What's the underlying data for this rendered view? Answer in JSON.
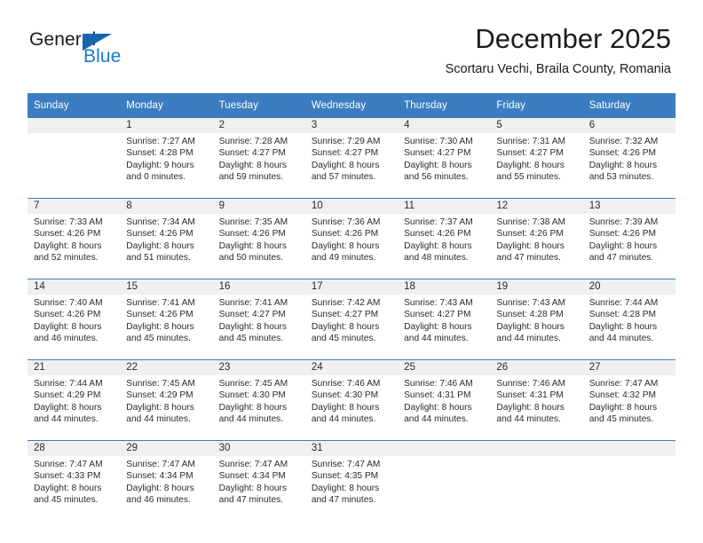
{
  "brand": {
    "word1": "General",
    "word2": "Blue",
    "triangle_color": "#1565b0",
    "blue_color": "#1779cf"
  },
  "header": {
    "month_title": "December 2025",
    "location": "Scortaru Vechi, Braila County, Romania"
  },
  "theme": {
    "header_blue": "#3b7dc0",
    "daynum_bg": "#f0f0f0",
    "text": "#2b2b2b"
  },
  "calendar": {
    "weekdays": [
      "Sunday",
      "Monday",
      "Tuesday",
      "Wednesday",
      "Thursday",
      "Friday",
      "Saturday"
    ],
    "weeks": [
      [
        {
          "day": "",
          "lines": []
        },
        {
          "day": "1",
          "lines": [
            "Sunrise: 7:27 AM",
            "Sunset: 4:28 PM",
            "Daylight: 9 hours",
            "and 0 minutes."
          ]
        },
        {
          "day": "2",
          "lines": [
            "Sunrise: 7:28 AM",
            "Sunset: 4:27 PM",
            "Daylight: 8 hours",
            "and 59 minutes."
          ]
        },
        {
          "day": "3",
          "lines": [
            "Sunrise: 7:29 AM",
            "Sunset: 4:27 PM",
            "Daylight: 8 hours",
            "and 57 minutes."
          ]
        },
        {
          "day": "4",
          "lines": [
            "Sunrise: 7:30 AM",
            "Sunset: 4:27 PM",
            "Daylight: 8 hours",
            "and 56 minutes."
          ]
        },
        {
          "day": "5",
          "lines": [
            "Sunrise: 7:31 AM",
            "Sunset: 4:27 PM",
            "Daylight: 8 hours",
            "and 55 minutes."
          ]
        },
        {
          "day": "6",
          "lines": [
            "Sunrise: 7:32 AM",
            "Sunset: 4:26 PM",
            "Daylight: 8 hours",
            "and 53 minutes."
          ]
        }
      ],
      [
        {
          "day": "7",
          "lines": [
            "Sunrise: 7:33 AM",
            "Sunset: 4:26 PM",
            "Daylight: 8 hours",
            "and 52 minutes."
          ]
        },
        {
          "day": "8",
          "lines": [
            "Sunrise: 7:34 AM",
            "Sunset: 4:26 PM",
            "Daylight: 8 hours",
            "and 51 minutes."
          ]
        },
        {
          "day": "9",
          "lines": [
            "Sunrise: 7:35 AM",
            "Sunset: 4:26 PM",
            "Daylight: 8 hours",
            "and 50 minutes."
          ]
        },
        {
          "day": "10",
          "lines": [
            "Sunrise: 7:36 AM",
            "Sunset: 4:26 PM",
            "Daylight: 8 hours",
            "and 49 minutes."
          ]
        },
        {
          "day": "11",
          "lines": [
            "Sunrise: 7:37 AM",
            "Sunset: 4:26 PM",
            "Daylight: 8 hours",
            "and 48 minutes."
          ]
        },
        {
          "day": "12",
          "lines": [
            "Sunrise: 7:38 AM",
            "Sunset: 4:26 PM",
            "Daylight: 8 hours",
            "and 47 minutes."
          ]
        },
        {
          "day": "13",
          "lines": [
            "Sunrise: 7:39 AM",
            "Sunset: 4:26 PM",
            "Daylight: 8 hours",
            "and 47 minutes."
          ]
        }
      ],
      [
        {
          "day": "14",
          "lines": [
            "Sunrise: 7:40 AM",
            "Sunset: 4:26 PM",
            "Daylight: 8 hours",
            "and 46 minutes."
          ]
        },
        {
          "day": "15",
          "lines": [
            "Sunrise: 7:41 AM",
            "Sunset: 4:26 PM",
            "Daylight: 8 hours",
            "and 45 minutes."
          ]
        },
        {
          "day": "16",
          "lines": [
            "Sunrise: 7:41 AM",
            "Sunset: 4:27 PM",
            "Daylight: 8 hours",
            "and 45 minutes."
          ]
        },
        {
          "day": "17",
          "lines": [
            "Sunrise: 7:42 AM",
            "Sunset: 4:27 PM",
            "Daylight: 8 hours",
            "and 45 minutes."
          ]
        },
        {
          "day": "18",
          "lines": [
            "Sunrise: 7:43 AM",
            "Sunset: 4:27 PM",
            "Daylight: 8 hours",
            "and 44 minutes."
          ]
        },
        {
          "day": "19",
          "lines": [
            "Sunrise: 7:43 AM",
            "Sunset: 4:28 PM",
            "Daylight: 8 hours",
            "and 44 minutes."
          ]
        },
        {
          "day": "20",
          "lines": [
            "Sunrise: 7:44 AM",
            "Sunset: 4:28 PM",
            "Daylight: 8 hours",
            "and 44 minutes."
          ]
        }
      ],
      [
        {
          "day": "21",
          "lines": [
            "Sunrise: 7:44 AM",
            "Sunset: 4:29 PM",
            "Daylight: 8 hours",
            "and 44 minutes."
          ]
        },
        {
          "day": "22",
          "lines": [
            "Sunrise: 7:45 AM",
            "Sunset: 4:29 PM",
            "Daylight: 8 hours",
            "and 44 minutes."
          ]
        },
        {
          "day": "23",
          "lines": [
            "Sunrise: 7:45 AM",
            "Sunset: 4:30 PM",
            "Daylight: 8 hours",
            "and 44 minutes."
          ]
        },
        {
          "day": "24",
          "lines": [
            "Sunrise: 7:46 AM",
            "Sunset: 4:30 PM",
            "Daylight: 8 hours",
            "and 44 minutes."
          ]
        },
        {
          "day": "25",
          "lines": [
            "Sunrise: 7:46 AM",
            "Sunset: 4:31 PM",
            "Daylight: 8 hours",
            "and 44 minutes."
          ]
        },
        {
          "day": "26",
          "lines": [
            "Sunrise: 7:46 AM",
            "Sunset: 4:31 PM",
            "Daylight: 8 hours",
            "and 44 minutes."
          ]
        },
        {
          "day": "27",
          "lines": [
            "Sunrise: 7:47 AM",
            "Sunset: 4:32 PM",
            "Daylight: 8 hours",
            "and 45 minutes."
          ]
        }
      ],
      [
        {
          "day": "28",
          "lines": [
            "Sunrise: 7:47 AM",
            "Sunset: 4:33 PM",
            "Daylight: 8 hours",
            "and 45 minutes."
          ]
        },
        {
          "day": "29",
          "lines": [
            "Sunrise: 7:47 AM",
            "Sunset: 4:34 PM",
            "Daylight: 8 hours",
            "and 46 minutes."
          ]
        },
        {
          "day": "30",
          "lines": [
            "Sunrise: 7:47 AM",
            "Sunset: 4:34 PM",
            "Daylight: 8 hours",
            "and 47 minutes."
          ]
        },
        {
          "day": "31",
          "lines": [
            "Sunrise: 7:47 AM",
            "Sunset: 4:35 PM",
            "Daylight: 8 hours",
            "and 47 minutes."
          ]
        },
        {
          "day": "",
          "lines": []
        },
        {
          "day": "",
          "lines": []
        },
        {
          "day": "",
          "lines": []
        }
      ]
    ]
  }
}
